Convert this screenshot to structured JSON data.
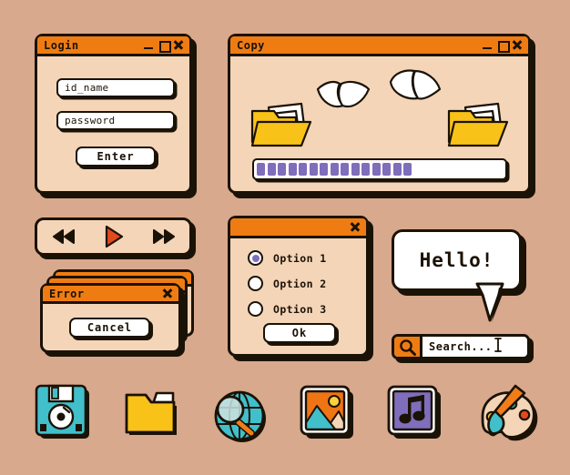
{
  "theme": {
    "background": "#d8a98d",
    "window_body": "#f4d5b8",
    "titlebar": "#ef7c13",
    "outline": "#1b1206",
    "accent_purple": "#7e6ebb",
    "accent_red": "#e2491c",
    "accent_yellow": "#f9c218",
    "accent_teal": "#41bfcb",
    "white": "#ffffff"
  },
  "login_window": {
    "title": "Login",
    "controls": [
      "minimize-icon",
      "maximize-icon",
      "close-icon"
    ],
    "fields": [
      {
        "name": "id-field",
        "value": "id_name"
      },
      {
        "name": "password-field",
        "value": "password"
      }
    ],
    "submit_label": "Enter"
  },
  "copy_window": {
    "title": "Copy",
    "controls": [
      "minimize-icon",
      "maximize-icon",
      "close-icon"
    ],
    "graphics": [
      "folder-source-icon",
      "flying-paper-icon",
      "flying-paper-icon",
      "folder-destination-icon"
    ],
    "progress": {
      "name": "copy-progress-bar",
      "segments_filled": 15,
      "segment_total": 24,
      "percent": 55,
      "segment_color": "#7e6ebb"
    }
  },
  "media_player": {
    "buttons": [
      {
        "name": "rewind-button",
        "icon": "rewind-icon"
      },
      {
        "name": "play-button",
        "icon": "play-icon"
      },
      {
        "name": "forward-button",
        "icon": "forward-icon"
      }
    ]
  },
  "error_window": {
    "title": "Error",
    "controls": [
      "close-icon"
    ],
    "stacked_copies": 3,
    "button_label": "Cancel"
  },
  "options_window": {
    "title": "",
    "controls": [
      "close-icon"
    ],
    "radios": [
      {
        "label": "Option 1",
        "selected": true
      },
      {
        "label": "Option 2",
        "selected": false
      },
      {
        "label": "Option 3",
        "selected": false
      }
    ],
    "confirm_label": "Ok"
  },
  "speech_bubble": {
    "text": "Hello!"
  },
  "search_bar": {
    "button_icon": "search-icon",
    "text": "Search...",
    "caret_icon": "text-cursor-icon"
  },
  "icon_row": [
    {
      "name": "floppy-disk-icon",
      "label": "floppy-disk"
    },
    {
      "name": "folder-icon",
      "label": "folder"
    },
    {
      "name": "globe-search-icon",
      "label": "globe-search"
    },
    {
      "name": "image-icon",
      "label": "image"
    },
    {
      "name": "music-icon",
      "label": "music"
    },
    {
      "name": "paint-palette-icon",
      "label": "paint-palette"
    }
  ]
}
